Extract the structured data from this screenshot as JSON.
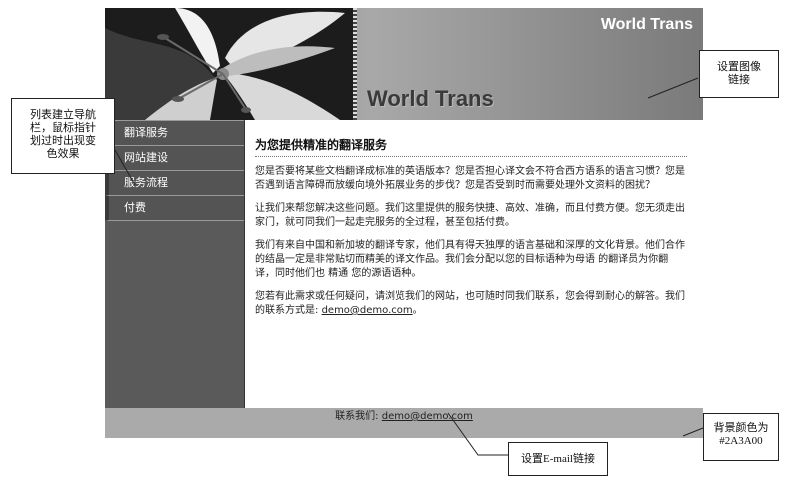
{
  "banner": {
    "title": "World Trans",
    "brand": "World Trans"
  },
  "nav": {
    "items": [
      {
        "label": "翻译服务"
      },
      {
        "label": "网站建设"
      },
      {
        "label": "服务流程"
      },
      {
        "label": "付费"
      }
    ]
  },
  "content": {
    "heading": "为您提供精准的翻译服务",
    "paragraphs": [
      "您是否要将某些文档翻译成标准的英语版本？您是否担心译文会不符合西方语系的语言习惯？您是否遇到语言障碍而放缓向境外拓展业务的步伐？您是否受到时而需要处理外文资料的困扰？",
      "让我们来帮您解决这些问题。我们这里提供的服务快捷、高效、准确，而且付费方便。您无须走出家门，就可同我们一起走完服务的全过程，甚至包括付费。",
      "我们有来自中国和新加坡的翻译专家，他们具有得天独厚的语言基础和深厚的文化背景。他们合作的结晶一定是非常贴切而精美的译文作品。我们会分配以您的目标语种为母语 的翻译员为你翻译，同时他们也 精通 您的源语语种。"
    ],
    "contact_text": "您若有此需求或任何疑问，请浏览我们的网站，也可随时同我们联系，您会得到耐心的解答。我们的联系方式是: ",
    "contact_email": "demo@demo.com",
    "contact_end": "。"
  },
  "footer": {
    "label": "联系我们: ",
    "email": "demo@demo.com"
  },
  "callouts": {
    "image_link": [
      "设置图像",
      "链接"
    ],
    "nav_hint": [
      "列表建立导航",
      "栏，鼠标指针",
      "划过时出现变",
      "色效果"
    ],
    "bg_color": [
      "背景颜色为",
      "#2A3A00"
    ],
    "email_link": "设置E-mail链接"
  },
  "colors": {
    "hover_bg": "#2A3A00",
    "sidebar": "#5a5a5a",
    "footer": "#aaaaaa"
  }
}
